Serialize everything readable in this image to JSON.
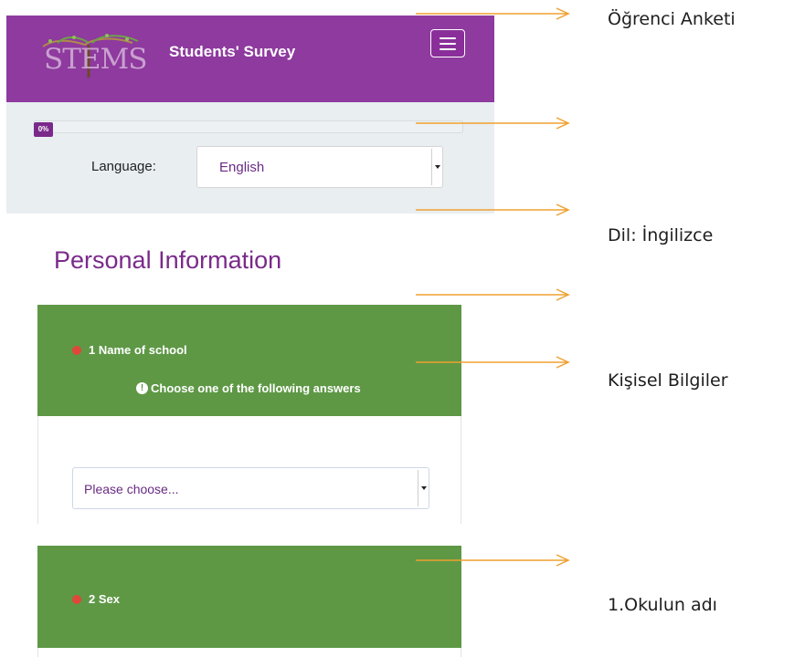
{
  "header": {
    "logo_text": "STEMS",
    "title": "Students' Survey",
    "menu_icon": "hamburger-icon",
    "brand_color": "#8e3a9e"
  },
  "progress": {
    "percent": 0,
    "label": "0%"
  },
  "language": {
    "label": "Language:",
    "selected": "English"
  },
  "section": {
    "title": "Personal Information"
  },
  "questions": [
    {
      "number_label": "1 Name of school",
      "hint": "Choose one of the following answers",
      "hint_icon": "info-icon",
      "select_placeholder": "Please choose..."
    },
    {
      "number_label": "2 Sex"
    }
  ],
  "annotations": [
    "Öğrenci Anketi",
    "Dil: İngilizce",
    "Kişisel Bilgiler",
    "1.Okulun adı"
  ],
  "colors": {
    "question_header": "#5e9845",
    "required_dot": "#e0473a",
    "arrow": "#f0a030"
  }
}
